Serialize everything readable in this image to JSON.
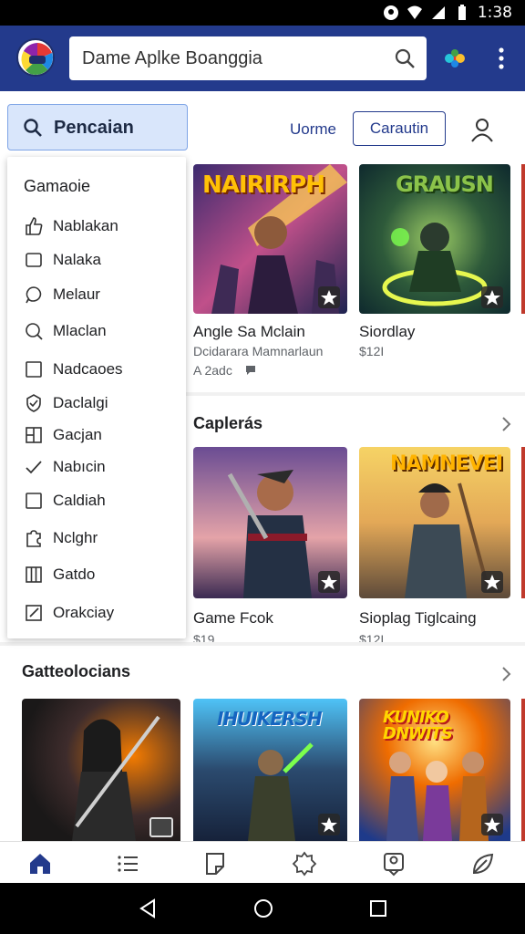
{
  "status_bar": {
    "time": "1:38",
    "icons": [
      "notification-icon",
      "wifi-icon",
      "signal-icon",
      "battery-icon"
    ]
  },
  "header": {
    "search_text": "Dame Aplke Boanggia",
    "icons": [
      "app-logo",
      "search-icon",
      "pin-icon",
      "more-icon"
    ]
  },
  "toolbar": {
    "search_button_label": "Pencaian",
    "home_link": "Uorme",
    "action_button": "Carautin"
  },
  "dropdown": {
    "title": "Gamaoie",
    "items": [
      {
        "label": "Nablakan",
        "icon": "thumbs-up-icon"
      },
      {
        "label": "Nalaka",
        "icon": "square-icon"
      },
      {
        "label": "Melaur",
        "icon": "chat-bubble-icon"
      },
      {
        "label": "Mlaclan",
        "icon": "search-icon"
      },
      {
        "label": "Nadcaoes",
        "icon": "square-icon"
      },
      {
        "label": "Daclalgi",
        "icon": "shield-check-icon"
      },
      {
        "label": "Gacjan",
        "icon": "grid-icon"
      },
      {
        "label": "Nabıcin",
        "icon": "check-icon"
      },
      {
        "label": "Caldiah",
        "icon": "square-icon"
      },
      {
        "label": "Nclghr",
        "icon": "puzzle-icon"
      },
      {
        "label": "Gatdo",
        "icon": "columns-icon"
      },
      {
        "label": "Orakciay",
        "icon": "edit-icon"
      }
    ]
  },
  "row1": {
    "cards": [
      {
        "banner": "NAIRIRPH",
        "title": "Angle Sa Mclain",
        "sub1": "Dcidarara Mamnarlaun",
        "sub2": "A 2adc"
      },
      {
        "banner": "GRAUSN",
        "title": "Siordlay",
        "sub1": "$12I",
        "sub2": ""
      }
    ]
  },
  "section2": {
    "title": "Caplerás",
    "cards": [
      {
        "banner": "",
        "title": "Game Fcok",
        "sub1": "$19"
      },
      {
        "banner": "NAMNEVEI",
        "title": "Sioplag Tiglcaing",
        "sub1": "$12I"
      }
    ]
  },
  "section3": {
    "title": "Gatteolocians",
    "cards": [
      {
        "banner": ""
      },
      {
        "banner": "IHUIKERSH"
      },
      {
        "banner": "KUNIKO DNWITS"
      }
    ]
  },
  "bottom_nav": [
    "home-icon",
    "list-icon",
    "bookmark-icon",
    "badge-icon",
    "profile-icon",
    "leaf-icon"
  ],
  "system_nav": [
    "back-icon",
    "home-circle-icon",
    "recents-icon"
  ],
  "colors": {
    "appbar": "#233a8c",
    "highlight": "#d9e6fb",
    "accent": "#233a8c"
  }
}
